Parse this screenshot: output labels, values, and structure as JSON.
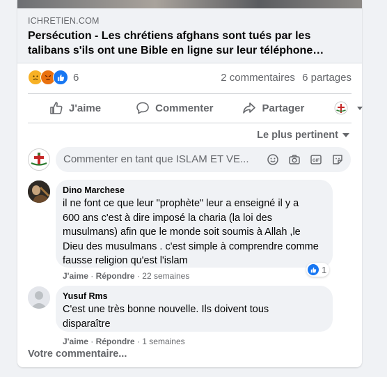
{
  "link": {
    "domain": "ICHRETIEN.COM",
    "title": "Persécution - Les chrétiens afghans sont tués par les talibans s'ils ont une Bible en ligne sur leur téléphone…"
  },
  "reactions": {
    "icons": [
      "sad-reaction-icon",
      "angry-reaction-icon",
      "like-reaction-icon"
    ],
    "count": "6",
    "comments": "2 commentaires",
    "shares": "6 partages"
  },
  "actions": {
    "like": "J'aime",
    "comment": "Commenter",
    "share": "Partager"
  },
  "sort": {
    "label": "Le plus pertinent"
  },
  "comment_box": {
    "placeholder": "Commenter en tant que ISLAM ET VE..."
  },
  "comments": [
    {
      "author": "Dino Marchese",
      "lines": [
        "il ne font ce que leur \"prophète\" leur a enseigné il y a",
        "600 ans c'est à dire imposé la charia (la loi des",
        "musulmans) afin que le monde soit soumis à Allah ,le",
        "Dieu des musulmans . c'est simple à comprendre comme",
        "fausse religion qu'est l'islam"
      ],
      "like": "J'aime",
      "reply": "Répondre",
      "time": "22 semaines",
      "like_count": "1"
    },
    {
      "author": "Yusuf Rms",
      "lines": [
        "C'est une très bonne nouvelle. Ils doivent tous",
        "disparaître"
      ],
      "like": "J'aime",
      "reply": "Répondre",
      "time": "1 semaines"
    }
  ],
  "footer": {
    "your_comment": "Votre commentaire..."
  },
  "colors": {
    "accent": "#1877f2",
    "secondary_text": "#65676b",
    "bubble_bg": "#f0f2f5"
  }
}
